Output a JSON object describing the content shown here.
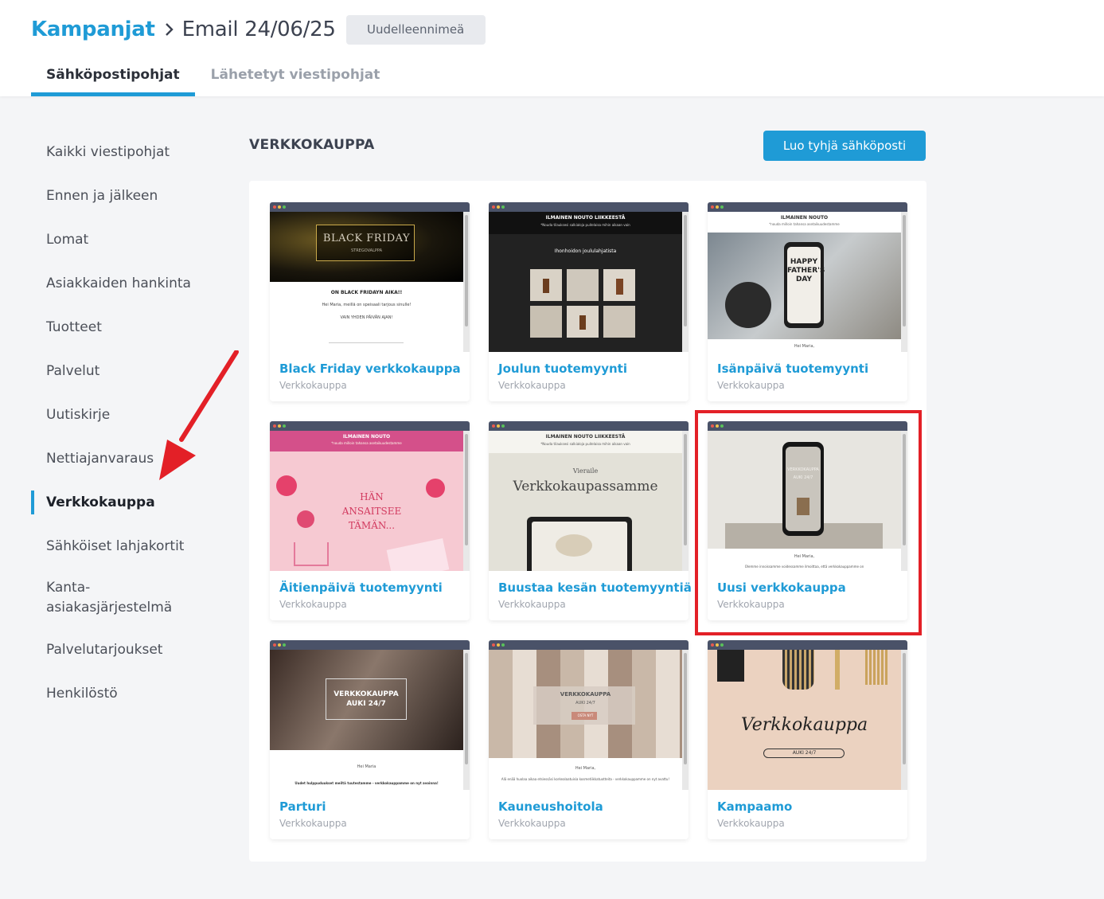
{
  "breadcrumb": {
    "parent": "Kampanjat",
    "current": "Email 24/06/25",
    "rename_label": "Uudelleennimeä"
  },
  "tabs": [
    {
      "label": "Sähköpostipohjat",
      "active": true
    },
    {
      "label": "Lähetetyt viestipohjat",
      "active": false
    }
  ],
  "sidebar": {
    "items": [
      {
        "label": "Kaikki viestipohjat"
      },
      {
        "label": "Ennen ja jälkeen"
      },
      {
        "label": "Lomat"
      },
      {
        "label": "Asiakkaiden hankinta"
      },
      {
        "label": "Tuotteet"
      },
      {
        "label": "Palvelut"
      },
      {
        "label": "Uutiskirje"
      },
      {
        "label": "Nettiajanvaraus"
      },
      {
        "label": "Verkkokauppa",
        "active": true
      },
      {
        "label": "Sähköiset lahjakortit"
      },
      {
        "label": "Kanta-asiakasjärjestelmä",
        "line1": "Kanta-",
        "line2": "asiakasjärjestelmä"
      },
      {
        "label": "Palvelutarjoukset"
      },
      {
        "label": "Henkilöstö"
      }
    ]
  },
  "main": {
    "section_title": "VERKKOKAUPPA",
    "create_label": "Luo tyhjä sähköposti",
    "cards": [
      {
        "title": "Black Friday verkkokauppa",
        "category": "Verkkokauppa",
        "preview": {
          "banner": "BLACK FRIDAY",
          "banner_sub": "STREGOVALPPA",
          "heading": "ON BLACK FRIDAYN AIKA!!",
          "line": "Hei Maria, meillä on speisaali tarjous sinulle!",
          "line2": "VAIN YHDEN PÄIVÄN AJAN!"
        }
      },
      {
        "title": "Joulun tuotemyynti",
        "category": "Verkkokauppa",
        "preview": {
          "header": "ILMAINEN NOUTO LIIKKEESTÄ",
          "header_sub": "*Nouda tilauksesi salkialoja puitelaisa mihin aikaan vain",
          "caption": "Ihonhoidon joululahjatista"
        }
      },
      {
        "title": "Isänpäivä tuotemyynti",
        "category": "Verkkokauppa",
        "preview": {
          "header": "ILMAINEN NOUTO",
          "header_sub": "*nouda milloin tahansa asetaikuudestamme",
          "phone_text": "HAPPY FATHER'S DAY",
          "footer": "Hei Maria,"
        }
      },
      {
        "title": "Äitienpäivä tuotemyynti",
        "category": "Verkkokauppa",
        "preview": {
          "header": "ILMAINEN NOUTO",
          "header_sub": "*nouda milloin tahansa asetaikuudestamme",
          "headline": "HÄN ANSAITSEE TÄMÄN..."
        }
      },
      {
        "title": "Buustaa kesän tuotemyyntiä",
        "category": "Verkkokauppa",
        "preview": {
          "header": "ILMAINEN NOUTO LIIKKEESTÄ",
          "header_sub": "*Nouda tilauksesi salkialoja puitelaisa mihin aikaan vain",
          "small": "Vieraile",
          "big": "Verkkokaupassamme"
        }
      },
      {
        "title": "Uusi verkkokauppa",
        "category": "Verkkokauppa",
        "preview": {
          "phone_text": "VERKKOKAUPPA AUKI 24/7",
          "line": "Hei Maria,",
          "line2": "Olemme innoissamme voidessamme ilmoittaa, että verkkokauppamme on"
        }
      },
      {
        "title": "Parturi",
        "category": "Verkkokauppa",
        "preview": {
          "overlay": "VERKKOKAUPPA AUKI 24/7",
          "line": "Hei Maria",
          "line2": "Uudet hulppuduukset meiltä tuutestamme - verkkokauppamme on nyt avoinna!"
        }
      },
      {
        "title": "Kauneushoitola",
        "category": "Verkkokauppa",
        "preview": {
          "overlay": "VERKKOKAUPPA",
          "overlay_sub": "AUKI 24/7",
          "button": "OSTA NYT",
          "line": "Hei Maria,",
          "line2": "Alä enää huolaa aikaa etsiessäsi korkealaatuisia kosmetiikkatuotteita - verkkokauppamme on nyt avattu!"
        }
      },
      {
        "title": "Kampaamo",
        "category": "Verkkokauppa",
        "preview": {
          "script": "Verkkokauppa",
          "pill": "AUKI 24/7"
        }
      }
    ]
  },
  "colors": {
    "accent": "#1f9bd6",
    "highlight": "#e32027",
    "arrow": "#e32027"
  }
}
